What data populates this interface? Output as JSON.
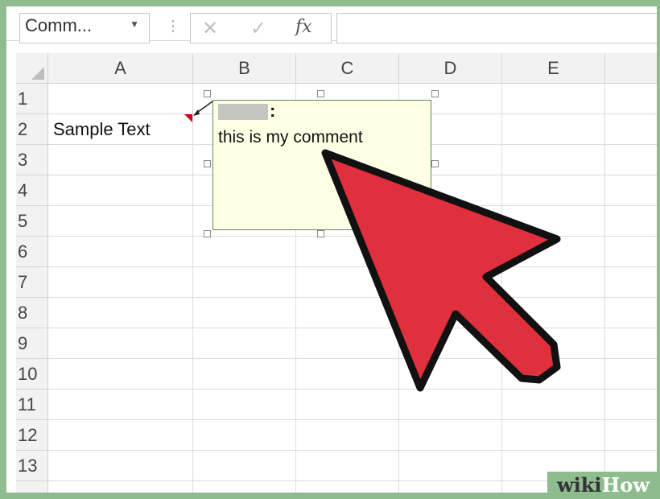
{
  "formula_bar": {
    "name_box_value": "Comm...",
    "dropdown_glyph": "▼",
    "separator": "⋮",
    "cancel_icon": "✕",
    "enter_icon": "✓",
    "fx_label": "fx",
    "formula_value": ""
  },
  "columns": [
    "A",
    "B",
    "C",
    "D",
    "E"
  ],
  "rows": [
    "1",
    "2",
    "3",
    "4",
    "5",
    "6",
    "7",
    "8",
    "9",
    "10",
    "11",
    "12",
    "13"
  ],
  "cells": {
    "A2": "Sample Text"
  },
  "comment": {
    "author_colon": ":",
    "text": "this is my comment"
  },
  "colors": {
    "frame": "#8fbc8f",
    "comment_bg": "#ffffe6",
    "indicator": "#d0021b",
    "arrow_fill": "#e0303e"
  },
  "watermark": {
    "part1": "wiki",
    "part2": "How"
  }
}
